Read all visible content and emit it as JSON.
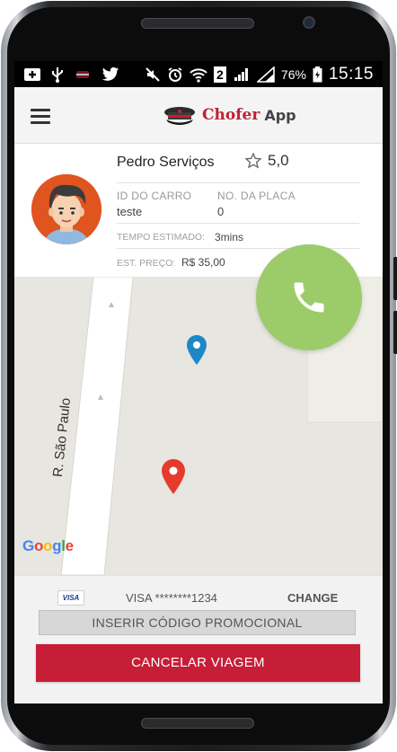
{
  "status_bar": {
    "battery_percent": "76%",
    "time": "15:15",
    "signal_sim": "2",
    "left_icons": [
      "notification-icon",
      "usb-icon",
      "app-icon",
      "twitter-icon"
    ],
    "right_icons": [
      "mute-icon",
      "alarm-icon",
      "wifi-icon",
      "signal-icon",
      "signal-icon",
      "battery-icon"
    ]
  },
  "app_bar": {
    "brand": "Chofer",
    "brand_suffix": "App",
    "menu_icon": "hamburger-icon"
  },
  "driver": {
    "name": "Pedro Serviços",
    "rating": "5,0",
    "car_id_label": "ID DO CARRO",
    "car_id_value": "teste",
    "plate_label": "NO. DA PLACA",
    "plate_value": "0",
    "eta_label": "TEMPO ESTIMADO:",
    "eta_value": "3mins",
    "price_label": "EST. PREÇO:",
    "price_value": "R$ 35,00"
  },
  "map": {
    "street_name": "R. São Paulo",
    "provider": "Google",
    "markers": [
      "pickup-marker",
      "destination-marker"
    ]
  },
  "payment": {
    "card_brand": "VISA",
    "card_number": "VISA ********1234",
    "change_label": "CHANGE",
    "promo_label": "INSERIR CÓDIGO PROMOCIONAL",
    "cancel_label": "CANCELAR VIAGEM"
  },
  "colors": {
    "accent": "#c71e37",
    "call_button": "#9ccc6a",
    "pickup_marker": "#1e88c7",
    "destination_marker": "#e53b2c"
  }
}
